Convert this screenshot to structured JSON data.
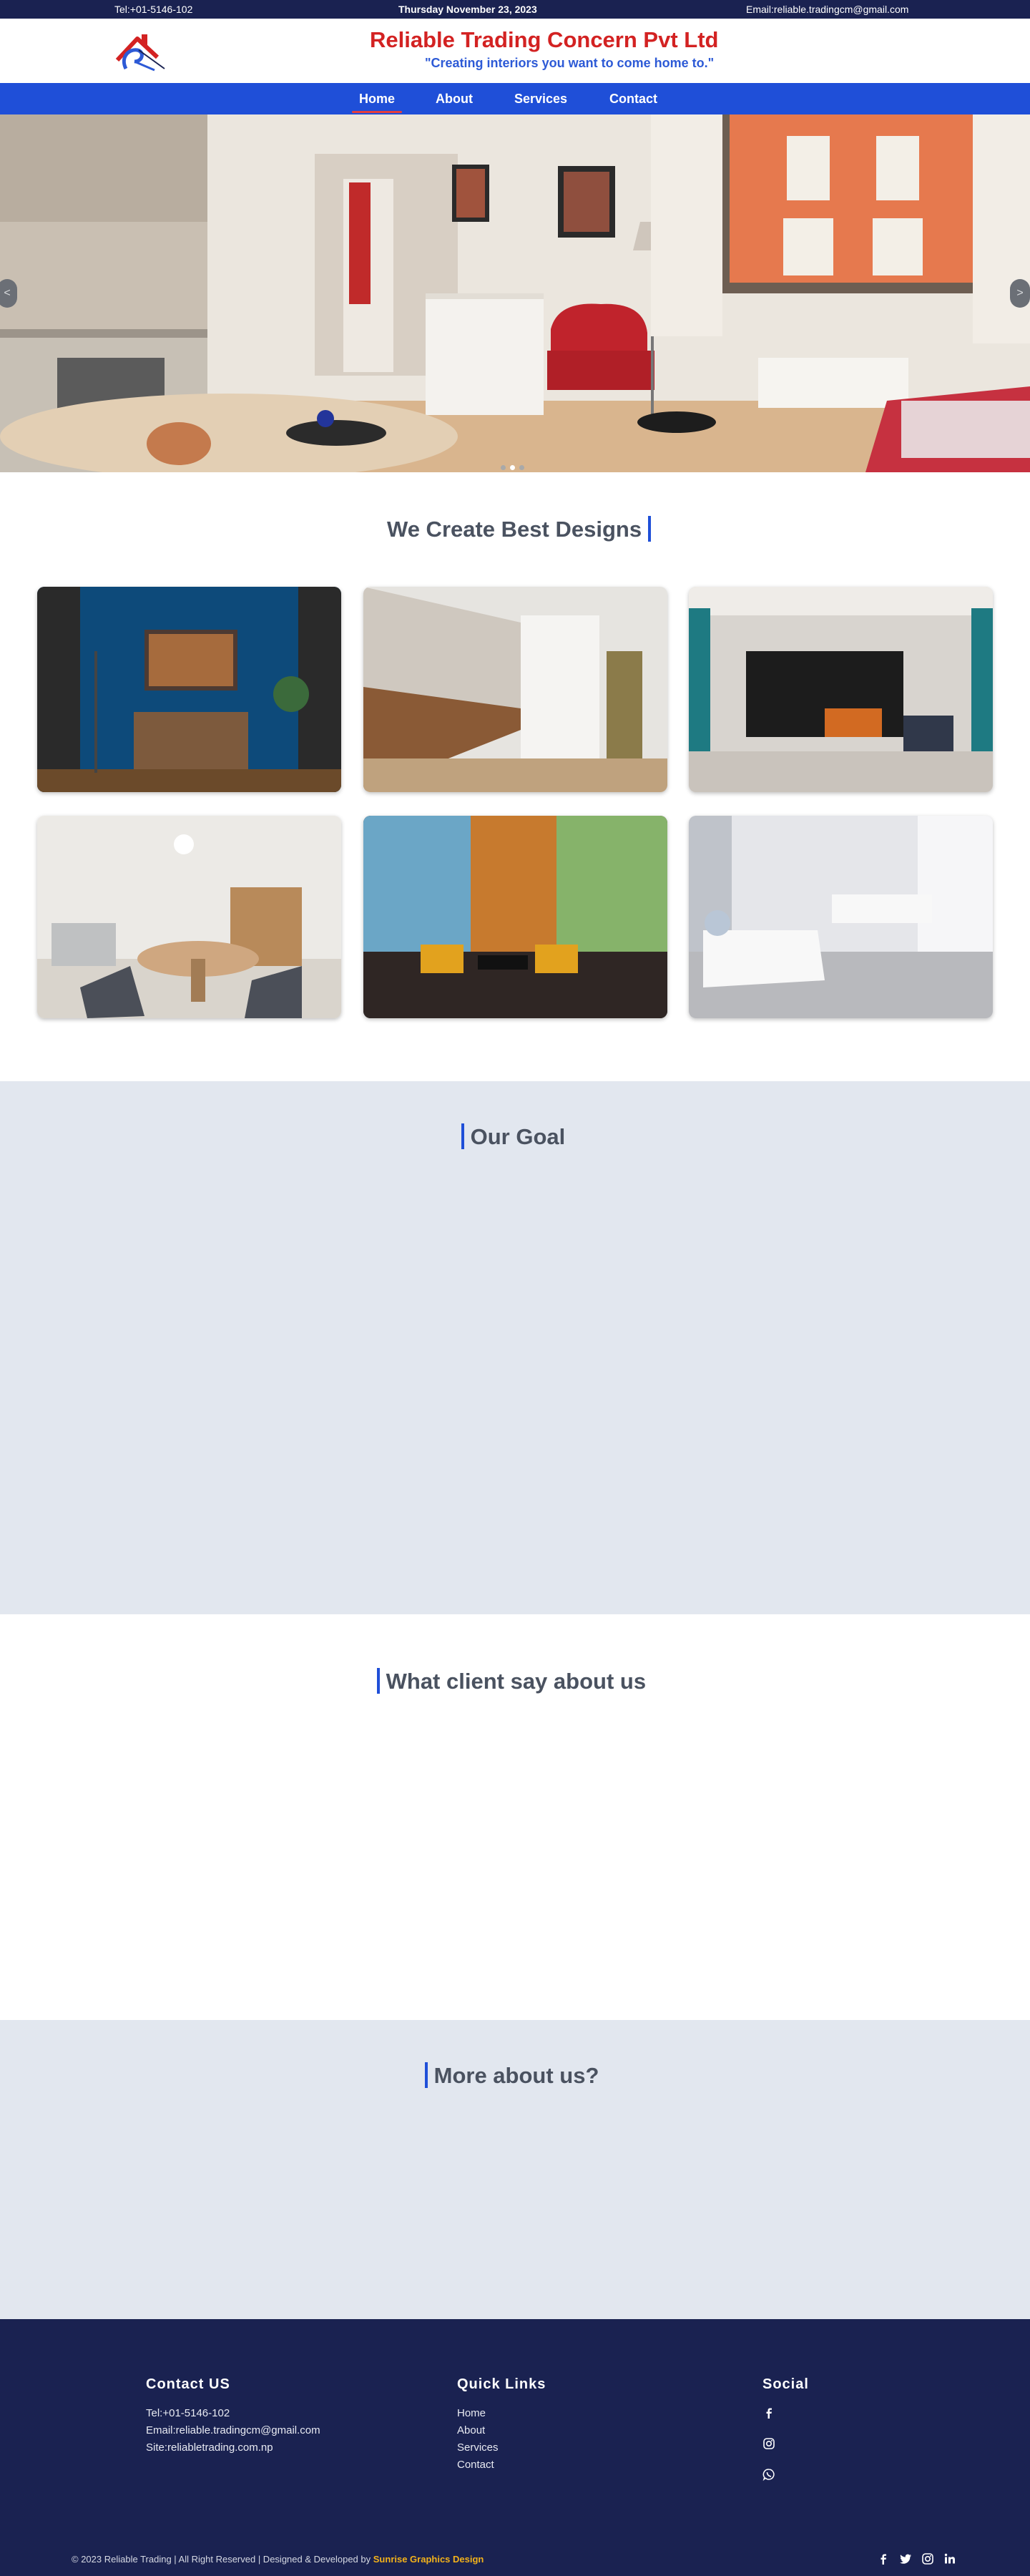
{
  "topbar": {
    "tel": "Tel:+01-5146-102",
    "date": "Thursday November 23, 2023",
    "email": "Email:reliable.tradingcm@gmail.com"
  },
  "header": {
    "brand": "Reliable Trading Concern Pvt Ltd",
    "slogan": "\"Creating interiors you want to come home to.\"",
    "logo_icon": "house-roof-logo"
  },
  "nav": {
    "items": [
      {
        "label": "Home",
        "active": true
      },
      {
        "label": "About",
        "active": false
      },
      {
        "label": "Services",
        "active": false
      },
      {
        "label": "Contact",
        "active": false
      }
    ]
  },
  "hero": {
    "prev_label": "<",
    "next_label": ">",
    "slides": 3,
    "active_slide": 2
  },
  "designs": {
    "title": "We Create Best Designs"
  },
  "goal": {
    "title": "Our Goal"
  },
  "clients": {
    "title": "What client say about us"
  },
  "more": {
    "title": "More about us?"
  },
  "footer": {
    "contact": {
      "heading": "Contact US",
      "tel": "Tel:+01-5146-102",
      "email": "Email:reliable.tradingcm@gmail.com",
      "site": "Site:reliabletrading.com.np"
    },
    "quick_links": {
      "heading": "Quick Links",
      "items": [
        "Home",
        "About",
        "Services",
        "Contact"
      ]
    },
    "social": {
      "heading": "Social",
      "icons": [
        "facebook-icon",
        "instagram-icon",
        "whatsapp-icon"
      ]
    },
    "copyright": "© 2023 Reliable Trading | All Right Reserved | Designed & Developed by",
    "developer": "Sunrise Graphics Design",
    "bottom_icons": [
      "facebook-icon",
      "twitter-icon",
      "instagram-icon",
      "linkedin-icon"
    ]
  },
  "colors": {
    "topbar": "#1a2251",
    "nav": "#1f4fd8",
    "brand": "#d32222",
    "slogan": "#2d5ad6",
    "section_bg": "#e2e7ef",
    "accent_bar": "#1f4fd8",
    "developer": "#f3b21a"
  }
}
